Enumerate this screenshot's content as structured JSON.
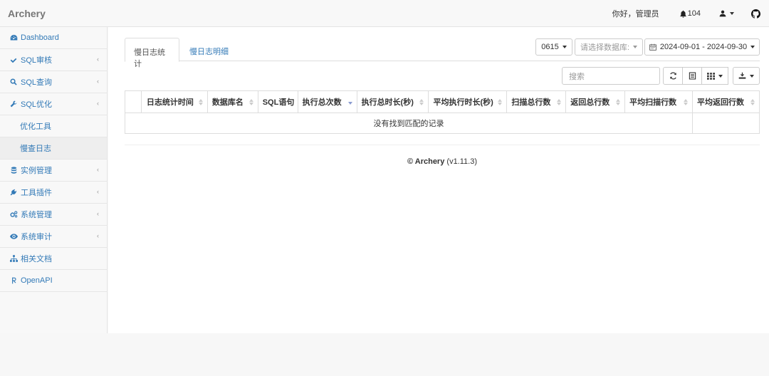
{
  "app": {
    "brand": "Archery"
  },
  "navbar": {
    "greeting": "你好，管理员",
    "notification_count": "104",
    "icons": [
      "bell-icon",
      "user-icon",
      "github-icon"
    ]
  },
  "sidebar": {
    "items": [
      {
        "label": "Dashboard",
        "icon": "dashboard-icon",
        "chevron": ""
      },
      {
        "label": "SQL审核",
        "icon": "check-icon",
        "chevron": "‹"
      },
      {
        "label": "SQL查询",
        "icon": "search-icon",
        "chevron": "‹"
      },
      {
        "label": "SQL优化",
        "icon": "wrench-icon",
        "chevron": "‹"
      },
      {
        "label": "优化工具",
        "icon": "",
        "chevron": ""
      },
      {
        "label": "慢查日志",
        "icon": "",
        "chevron": ""
      },
      {
        "label": "实例管理",
        "icon": "database-icon",
        "chevron": "‹"
      },
      {
        "label": "工具插件",
        "icon": "plug-icon",
        "chevron": "‹"
      },
      {
        "label": "系统管理",
        "icon": "cogs-icon",
        "chevron": "‹"
      },
      {
        "label": "系统审计",
        "icon": "eye-icon",
        "chevron": "‹"
      },
      {
        "label": "相关文档",
        "icon": "sitemap-icon",
        "chevron": ""
      },
      {
        "label": "OpenAPI",
        "icon": "api-icon",
        "chevron": ""
      }
    ]
  },
  "main": {
    "tabs": [
      {
        "label": "慢日志统计",
        "active": true
      },
      {
        "label": "慢日志明细",
        "active": false
      }
    ],
    "filters": {
      "instance": "0615",
      "database_placeholder": "请选择数据库:",
      "date_range": "2024-09-01 - 2024-09-30"
    },
    "toolbar": {
      "search_placeholder": "搜索",
      "icons": [
        "refresh-icon",
        "toggle-view-icon",
        "columns-icon",
        "export-icon"
      ]
    },
    "table": {
      "columns": [
        "",
        "日志统计时间",
        "数据库名",
        "SQL语句",
        "执行总次数",
        "执行总时长(秒)",
        "平均执行时长(秒)",
        "扫描总行数",
        "返回总行数",
        "平均扫描行数",
        "平均返回行数"
      ],
      "sorted_column": "执行总次数",
      "sort_direction": "desc",
      "empty_message": "没有找到匹配的记录"
    },
    "footer": {
      "copyright": "© Archery",
      "version": "(v1.11.3)"
    }
  }
}
